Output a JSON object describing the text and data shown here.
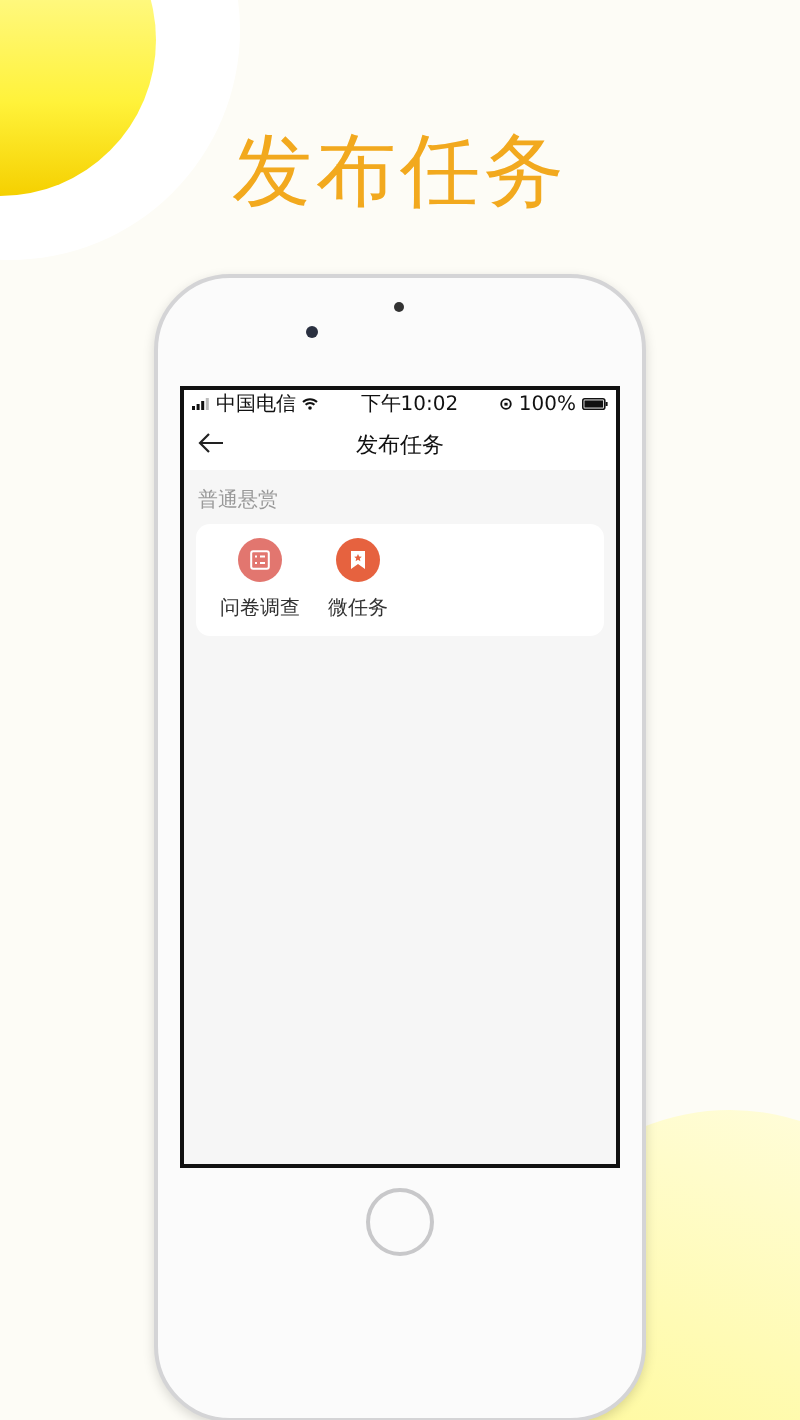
{
  "headline": "发布任务",
  "status_bar": {
    "carrier": "中国电信",
    "time": "下午10:02",
    "battery": "100%"
  },
  "nav": {
    "title": "发布任务"
  },
  "section": {
    "label": "普通悬赏",
    "items": [
      {
        "label": "问卷调查",
        "kind": "survey",
        "color": "#e2766f"
      },
      {
        "label": "微任务",
        "kind": "task",
        "color": "#e6623f"
      }
    ]
  }
}
